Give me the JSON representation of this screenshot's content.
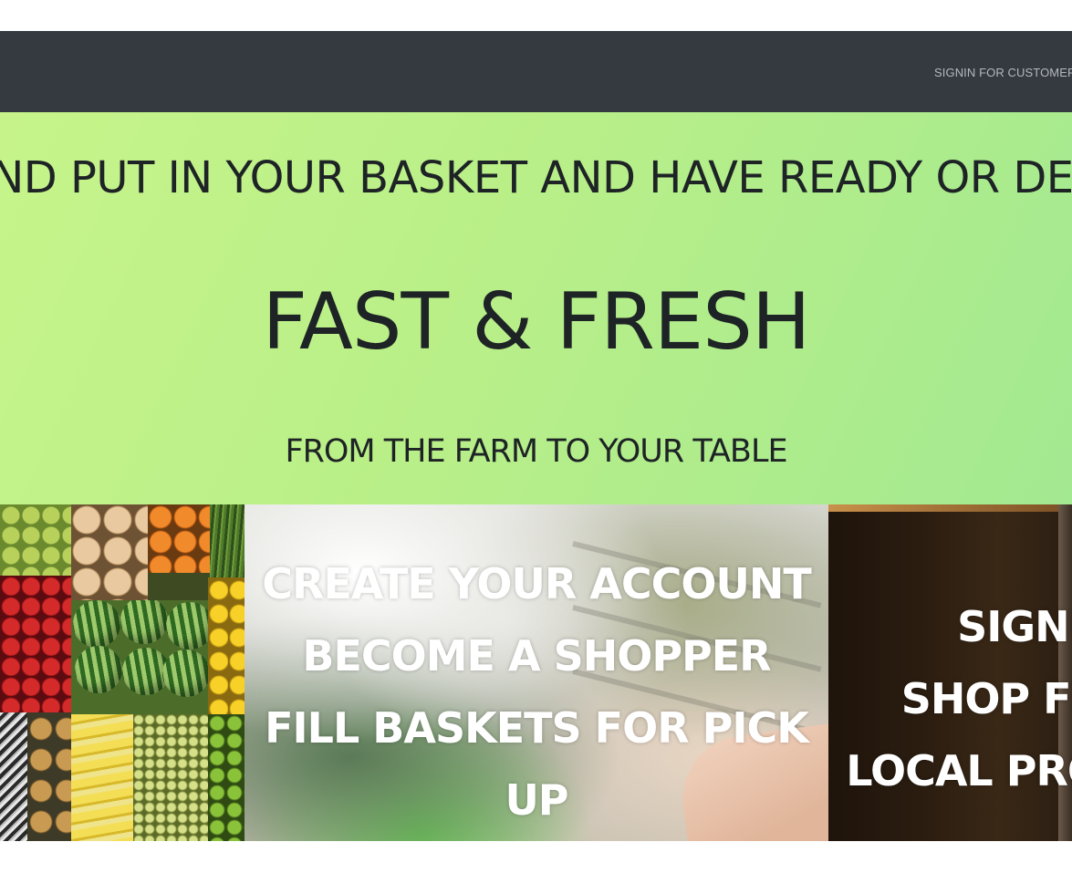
{
  "navbar": {
    "signin_link": "SIGNIN FOR CUSTOMERS"
  },
  "hero": {
    "marquee_text": "AND PUT IN YOUR BASKET AND HAVE READY OR DE",
    "title": "FAST & FRESH",
    "subtitle": "FROM THE FARM TO YOUR TABLE"
  },
  "tiles": {
    "shopper": {
      "line1": "CREATE YOUR ACCOUNT",
      "line2": "BECOME A SHOPPER",
      "line3": "FILL BASKETS FOR PICK",
      "line4": "UP"
    },
    "signup": {
      "line1": "SIGNU",
      "line2": "SHOP FR",
      "line3": "LOCAL PRO"
    }
  },
  "colors": {
    "navbar_bg": "#343a40",
    "hero_gradient_start": "#c6f48a",
    "hero_gradient_end": "#a3e991",
    "text_dark": "#1e2326"
  }
}
